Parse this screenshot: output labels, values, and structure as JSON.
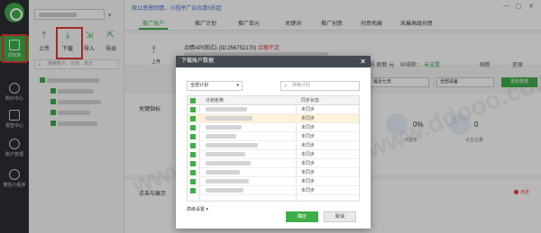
{
  "rail": {
    "items": [
      {
        "label": "词包数"
      },
      {
        "label": "购价中心"
      },
      {
        "label": "报告中心"
      },
      {
        "label": "账户管理"
      },
      {
        "label": "微信小程序"
      }
    ]
  },
  "tree": {
    "toolbar": {
      "upload": "上传",
      "download": "下载",
      "import": "导入",
      "export": "导出"
    },
    "search_placeholder": "搜索账户、计划、单元"
  },
  "topbar": {
    "notice": "双11感恩回馈，小程序广告优惠5折起"
  },
  "tabs": [
    "推广账户",
    "推广计划",
    "推广单元",
    "关键词",
    "推广创意",
    "创意拓展",
    "凤巢高级创意"
  ],
  "account": {
    "upload_label": "上传",
    "id_text": "点睛API测试1 (ID:256752170)",
    "warning": "余额不足",
    "ip_exclude": "IP排除：",
    "not_set": "未设置",
    "refresh": "刷新",
    "restore": "还原",
    "hint_fragment": "号 刷新 元"
  },
  "filters": {
    "range": "最近七天",
    "device": "全部设备",
    "update": "更新数据"
  },
  "kpi": {
    "title": "关键指标",
    "items": [
      {
        "value": "",
        "label": ""
      },
      {
        "value": "0%",
        "label": "点击率"
      },
      {
        "value": "0",
        "label": "点击总量"
      }
    ]
  },
  "trend": {
    "title": "点击与展示",
    "legend": "点击"
  },
  "watermark": "www.ddooo.com",
  "dialog": {
    "title": "下载账户数据",
    "scope": "全部计划",
    "search_placeholder": "搜索计划",
    "columns": {
      "name": "计划名称",
      "status": "同步状态"
    },
    "rows": [
      {
        "status": "未同步"
      },
      {
        "status": "未同步"
      },
      {
        "status": "未同步"
      },
      {
        "status": "未同步"
      },
      {
        "status": "未同步"
      },
      {
        "status": "未同步"
      },
      {
        "status": "未同步"
      },
      {
        "status": "未同步"
      },
      {
        "status": "未同步"
      },
      {
        "status": "未同步"
      }
    ],
    "advanced": "高级设置",
    "ok": "确定",
    "cancel": "取消"
  }
}
